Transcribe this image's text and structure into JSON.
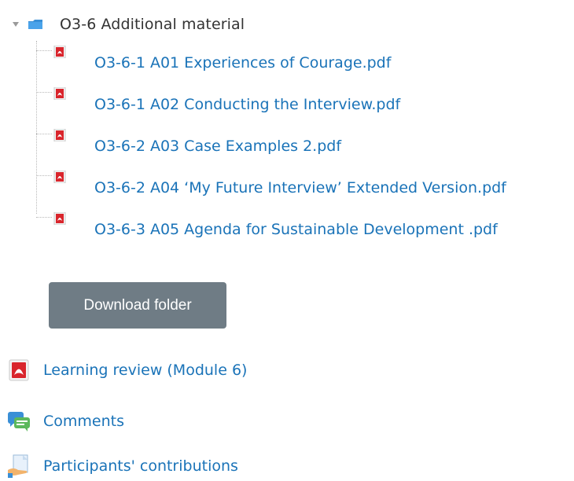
{
  "folder": {
    "label": "O3-6 Additional material",
    "toggle_icon": "triangle-down-icon",
    "icon": "folder-icon",
    "files": [
      {
        "label": "O3-6-1 A01 Experiences of Courage.pdf",
        "icon": "pdf-icon"
      },
      {
        "label": "O3-6-1 A02 Conducting the Interview.pdf",
        "icon": "pdf-icon"
      },
      {
        "label": "O3-6-2 A03 Case Examples 2.pdf",
        "icon": "pdf-icon"
      },
      {
        "label": "O3-6-2 A04 ‘My Future Interview’ Extended Version.pdf",
        "icon": "pdf-icon"
      },
      {
        "label": "O3-6-3 A05 Agenda for Sustainable Development .pdf",
        "icon": "pdf-icon"
      }
    ]
  },
  "download_button": {
    "label": "Download folder"
  },
  "activities": [
    {
      "label": "Learning review (Module 6)",
      "icon": "pdf-icon"
    },
    {
      "label": "Comments",
      "icon": "chat-bubbles-icon"
    },
    {
      "label": "Participants' contributions",
      "icon": "document-hand-icon"
    }
  ],
  "colors": {
    "link": "#1a73b8",
    "button_bg": "#6f7c85",
    "folder_blue": "#3a8fd6",
    "pdf_red": "#d9252c"
  }
}
